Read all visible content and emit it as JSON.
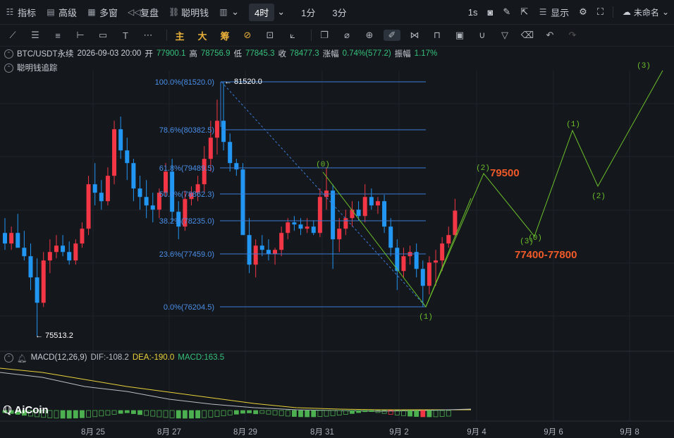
{
  "topbar": {
    "indicators": "指标",
    "advanced": "高级",
    "multi_window": "多窗",
    "replay": "复盘",
    "smart_money": "聪明钱",
    "timeframe": "4时",
    "tf_1m": "1分",
    "tf_3m": "3分",
    "tf_1s": "1s",
    "display": "显示",
    "unnamed": "未命名"
  },
  "toolbar": {
    "main": "主",
    "big": "大",
    "chips": "筹"
  },
  "legend": {
    "symbol": "BTC/USDT永续",
    "datetime": "2026-09-03 20:00",
    "open_label": "开",
    "open": "77900.1",
    "high_label": "高",
    "high": "78756.9",
    "low_label": "低",
    "low": "77845.3",
    "close_label": "收",
    "close": "78477.3",
    "chg_label": "涨幅",
    "chg": "0.74%(577.2)",
    "amp_label": "振幅",
    "amp": "1.17%",
    "tracker": "聪明钱追踪"
  },
  "macd": {
    "name": "MACD(12,26,9)",
    "dif": "DIF:-108.2",
    "dea": "DEA:-190.0",
    "macd": "MACD:163.5"
  },
  "fib": [
    {
      "label": "100.0%(81520.0)"
    },
    {
      "label": "78.6%(80382.5)"
    },
    {
      "label": "61.8%(79489.5)"
    },
    {
      "label": "50.0%(78862.3)"
    },
    {
      "label": "38.2%(78235.0)"
    },
    {
      "label": "23.6%(77459.0)"
    },
    {
      "label": "0.0%(76204.5)"
    }
  ],
  "annotations": {
    "high_marker": "81520.0",
    "low_marker": "75513.2",
    "target_up": "79500",
    "target_zone": "77400-77800",
    "wave_0": "(0)",
    "wave_1": "(1)",
    "wave_2": "(2)",
    "wave_3": "(3)"
  },
  "xaxis": [
    "8月 25",
    "8月 27",
    "8月 29",
    "8月 31",
    "9月 2",
    "9月 4",
    "9月 6",
    "9月 8"
  ],
  "logo": "AiCoin",
  "colors": {
    "up": "#f23645",
    "down": "#2196f3",
    "wave": "#6bbf2a",
    "fib": "#3a7bd5",
    "target": "#f05a28"
  }
}
